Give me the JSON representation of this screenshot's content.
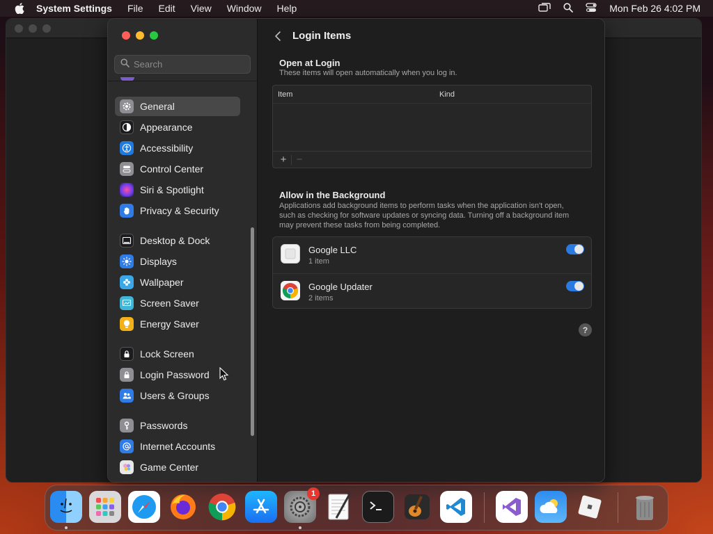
{
  "menubar": {
    "app_name": "System Settings",
    "items": [
      "File",
      "Edit",
      "View",
      "Window",
      "Help"
    ],
    "clock": "Mon Feb 26  4:02 PM"
  },
  "sidebar": {
    "search_placeholder": "Search",
    "items": [
      {
        "label": "General",
        "icon": "gear-icon",
        "color": "#8e8e93",
        "selected": true
      },
      {
        "label": "Appearance",
        "icon": "appearance-icon",
        "color": "#1c1c1e"
      },
      {
        "label": "Accessibility",
        "icon": "accessibility-icon",
        "color": "#1f7ae0"
      },
      {
        "label": "Control Center",
        "icon": "control-center-icon",
        "color": "#8e8e93"
      },
      {
        "label": "Siri & Spotlight",
        "icon": "siri-icon",
        "color": "#c04bd6"
      },
      {
        "label": "Privacy & Security",
        "icon": "hand-icon",
        "color": "#2f7ce6"
      },
      {
        "label": "Desktop & Dock",
        "icon": "dock-icon",
        "color": "#1c1c1e"
      },
      {
        "label": "Displays",
        "icon": "sun-icon",
        "color": "#2f7ce6"
      },
      {
        "label": "Wallpaper",
        "icon": "flower-icon",
        "color": "#3aa8e8"
      },
      {
        "label": "Screen Saver",
        "icon": "screensaver-icon",
        "color": "#3fb6d8"
      },
      {
        "label": "Energy Saver",
        "icon": "bulb-icon",
        "color": "#f2b116"
      },
      {
        "label": "Lock Screen",
        "icon": "lock-icon",
        "color": "#1c1c1e"
      },
      {
        "label": "Login Password",
        "icon": "lock-icon",
        "color": "#8e8e93"
      },
      {
        "label": "Users & Groups",
        "icon": "users-icon",
        "color": "#2f7ce6"
      },
      {
        "label": "Passwords",
        "icon": "key-icon",
        "color": "#8e8e93"
      },
      {
        "label": "Internet Accounts",
        "icon": "at-icon",
        "color": "#2f7ce6"
      },
      {
        "label": "Game Center",
        "icon": "game-center-icon",
        "color": "#e8e8e8"
      }
    ]
  },
  "content": {
    "title": "Login Items",
    "open_at_login": {
      "title": "Open at Login",
      "description": "These items will open automatically when you log in.",
      "col_item": "Item",
      "col_kind": "Kind",
      "add": "+",
      "remove": "−"
    },
    "background": {
      "title": "Allow in the Background",
      "description": "Applications add background items to perform tasks when the application isn't open, such as checking for software updates or syncing data. Turning off a background item may prevent these tasks from being completed.",
      "rows": [
        {
          "name": "Google LLC",
          "sub": "1 item",
          "enabled": true
        },
        {
          "name": "Google Updater",
          "sub": "2 items",
          "enabled": true
        }
      ]
    },
    "help": "?"
  },
  "dock": {
    "apps": [
      "Finder",
      "Launchpad",
      "Safari",
      "Firefox",
      "Chrome",
      "App Store",
      "System Settings",
      "TextEdit",
      "Terminal",
      "GarageBand",
      "VS Code",
      "Visual Studio",
      "Weather",
      "Roblox",
      "Trash"
    ],
    "settings_badge": "1"
  }
}
